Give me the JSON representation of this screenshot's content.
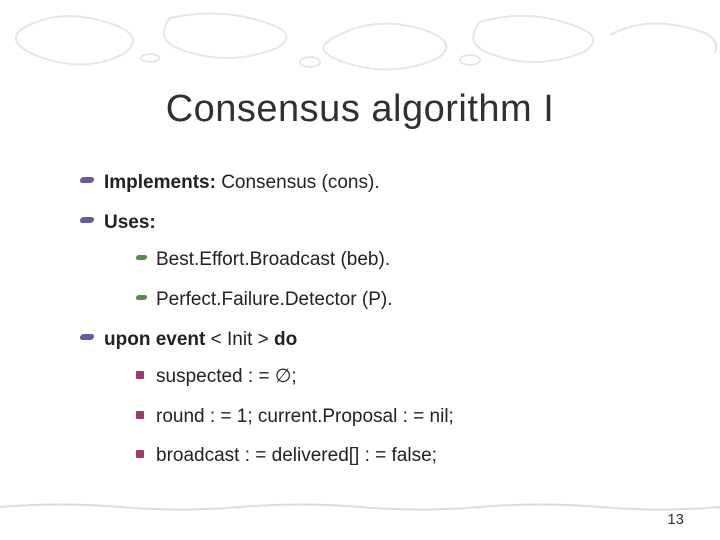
{
  "title": "Consensus algorithm I",
  "bullets": {
    "implements_label": "Implements:",
    "implements_value": "  Consensus (cons).",
    "uses_label": "Uses:",
    "uses_items": [
      "Best.Effort.Broadcast (beb).",
      "Perfect.Failure.Detector (P)."
    ],
    "event_prefix": "upon event",
    "event_mid": " < Init > ",
    "event_suffix": "do",
    "event_items": [
      "suspected : = ∅;",
      "round : = 1; current.Proposal : = nil;",
      "broadcast : = delivered[] : = false;"
    ]
  },
  "page_number": "13"
}
